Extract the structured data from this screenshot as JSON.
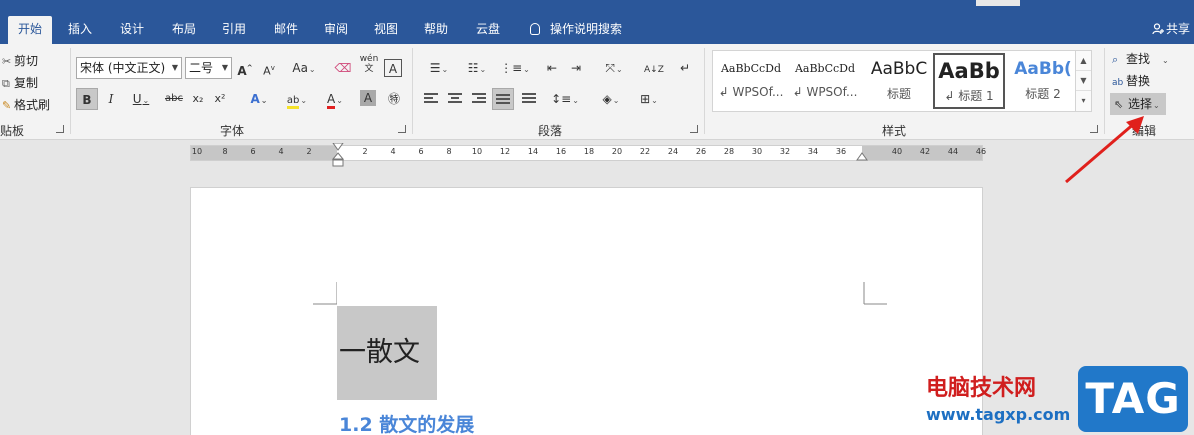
{
  "window": {
    "stub_left": "",
    "stub_right": ""
  },
  "tabs": [
    {
      "label": "开始",
      "active": true
    },
    {
      "label": "插入"
    },
    {
      "label": "设计"
    },
    {
      "label": "布局"
    },
    {
      "label": "引用"
    },
    {
      "label": "邮件"
    },
    {
      "label": "审阅"
    },
    {
      "label": "视图"
    },
    {
      "label": "帮助"
    },
    {
      "label": "云盘"
    }
  ],
  "tell_me": "操作说明搜索",
  "share": "共享",
  "clipboard": {
    "cut": "剪切",
    "copy": "复制",
    "painter": "格式刷",
    "group_label": "贴板"
  },
  "font": {
    "font_name": "宋体 (中文正文)",
    "font_size": "二号",
    "grow": "A",
    "shrink": "A",
    "case": "Aa",
    "phonetic": "wén",
    "bold": "B",
    "italic": "I",
    "underline": "U",
    "strike": "abc",
    "sub": "x₂",
    "sup": "x²",
    "effects": "A",
    "highlight": "ab",
    "color": "A",
    "shade": "A",
    "group_label": "字体"
  },
  "paragraph": {
    "group_label": "段落"
  },
  "styles": {
    "items": [
      {
        "sample": "AaBbCcDd",
        "name": "↲ WPSOf..."
      },
      {
        "sample": "AaBbCcDd",
        "name": "↲ WPSOf..."
      },
      {
        "sample": "AaBbC",
        "name": "标题"
      },
      {
        "sample": "AaBb",
        "name": "↲ 标题 1",
        "selected": true
      },
      {
        "sample": "AaBb(",
        "name": "标题 2"
      }
    ],
    "group_label": "样式"
  },
  "editing": {
    "find": "查找",
    "replace": "替换",
    "select": "选择",
    "group_label": "编辑"
  },
  "ruler": {
    "numbers": [
      "10",
      "8",
      "6",
      "4",
      "2",
      "",
      "2",
      "4",
      "6",
      "8",
      "10",
      "12",
      "14",
      "16",
      "18",
      "20",
      "22",
      "24",
      "26",
      "28",
      "30",
      "32",
      "34",
      "36",
      "",
      "40",
      "42",
      "44",
      "46"
    ]
  },
  "document": {
    "heading1": "一散文",
    "heading2": "1.2 散文的发展"
  },
  "watermark": {
    "site_name": "电脑技术网",
    "url": "www.tagxp.com",
    "tag": "TAG"
  },
  "colors": {
    "ribbon_blue": "#2b579a",
    "heading2_blue": "#4a86d8",
    "arrow_red": "#e0201c"
  }
}
